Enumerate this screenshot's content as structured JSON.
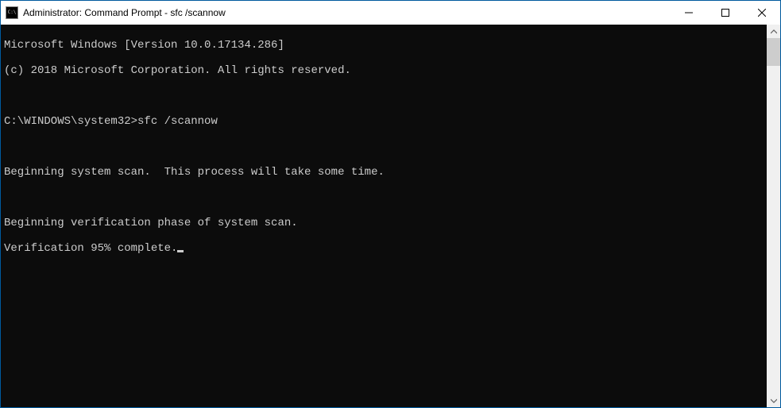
{
  "titlebar": {
    "title": "Administrator: Command Prompt - sfc  /scannow"
  },
  "console": {
    "version_line": "Microsoft Windows [Version 10.0.17134.286]",
    "copyright_line": "(c) 2018 Microsoft Corporation. All rights reserved.",
    "prompt": "C:\\WINDOWS\\system32>",
    "command": "sfc /scannow",
    "scan_begin": "Beginning system scan.  This process will take some time.",
    "verify_begin": "Beginning verification phase of system scan.",
    "verify_progress": "Verification 95% complete."
  }
}
